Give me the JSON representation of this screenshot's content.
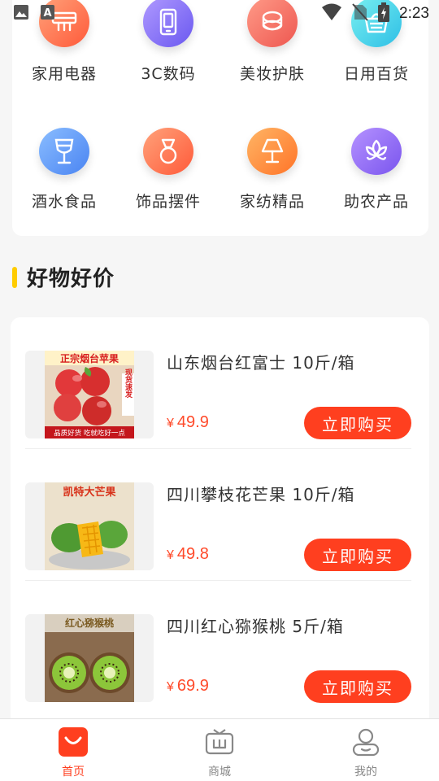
{
  "status_bar": {
    "time": "2:23",
    "icons": [
      "image-icon",
      "font-icon",
      "wifi-icon",
      "no-sim-icon",
      "battery-charging-icon"
    ]
  },
  "categories": [
    {
      "label": "家用电器",
      "icon": "appliance-icon",
      "color_from": "#ff9b6a",
      "color_to": "#ff5a3a"
    },
    {
      "label": "3C数码",
      "icon": "phone-icon",
      "color_from": "#a98dff",
      "color_to": "#6f5cf3"
    },
    {
      "label": "美妆护肤",
      "icon": "cosmetics-icon",
      "color_from": "#ff8f7c",
      "color_to": "#f25f56"
    },
    {
      "label": "日用百货",
      "icon": "basket-icon",
      "color_from": "#6fe9ee",
      "color_to": "#2fc4e6"
    },
    {
      "label": "酒水食品",
      "icon": "wine-glass-icon",
      "color_from": "#7fb6ff",
      "color_to": "#4a86f2"
    },
    {
      "label": "饰品摆件",
      "icon": "jewelry-icon",
      "color_from": "#ff9c6e",
      "color_to": "#ff5f45"
    },
    {
      "label": "家纺精品",
      "icon": "lamp-icon",
      "color_from": "#ffae5a",
      "color_to": "#ff7a2a"
    },
    {
      "label": "助农产品",
      "icon": "plant-icon",
      "color_from": "#ad86ff",
      "color_to": "#7d5af0"
    }
  ],
  "section": {
    "title": "好物好价",
    "accent": "#ffcc00"
  },
  "products": [
    {
      "name": "山东烟台红富士 10斤/箱",
      "currency": "¥",
      "price": "49.9",
      "buy_label": "立即购买",
      "image": "apple-photo",
      "image_text": {
        "banner": "正宗烟台苹果",
        "badge": "现货速发",
        "footer": "晶质好货 吃就吃好一点"
      }
    },
    {
      "name": "四川攀枝花芒果 10斤/箱",
      "currency": "¥",
      "price": "49.8",
      "buy_label": "立即购买",
      "image": "mango-photo",
      "image_text": {
        "banner": "凯特大芒果"
      }
    },
    {
      "name": "四川红心猕猴桃 5斤/箱",
      "currency": "¥",
      "price": "69.9",
      "buy_label": "立即购买",
      "image": "kiwi-photo",
      "image_text": {
        "banner": "红心猕猴桃"
      }
    }
  ],
  "bottom_nav": [
    {
      "label": "首页",
      "icon": "home-icon",
      "active": true
    },
    {
      "label": "商城",
      "icon": "store-icon",
      "active": false
    },
    {
      "label": "我的",
      "icon": "profile-icon",
      "active": false
    }
  ],
  "colors": {
    "accent": "#ff3f1f",
    "price": "#ff4a2a",
    "background": "#f6f6f6"
  }
}
